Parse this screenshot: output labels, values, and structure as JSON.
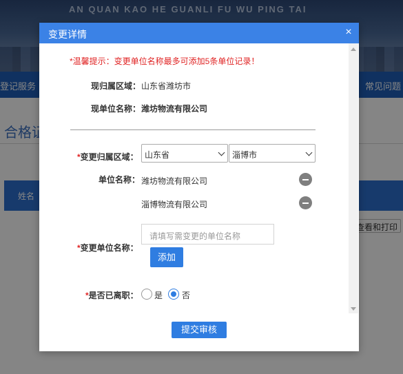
{
  "background": {
    "banner_subtitle": "AN QUAN KAO HE GUANLI FU WU PING TAI",
    "nav_left": "登记服务",
    "nav_right": "常见问题",
    "section_title": "合格证",
    "table_header_first": "姓名",
    "print_button": "查看和打印"
  },
  "dialog": {
    "title": "变更详情",
    "close_icon": "×",
    "tip": "*温馨提示：变更单位名称最多可添加5条单位记录！",
    "current_region_label": "现归属区域：",
    "current_region_value": "山东省潍坊市",
    "current_unit_label": "现单位名称：",
    "current_unit_value": "潍坊物流有限公司",
    "change_region_label": "变更归属区域：",
    "province_select": "山东省",
    "city_select": "淄博市",
    "unit_list_label": "单位名称：",
    "units": [
      "潍坊物流有限公司",
      "淄博物流有限公司"
    ],
    "change_unit_label": "变更单位名称：",
    "unit_input_placeholder": "请填写需变更的单位名称",
    "add_button": "添加",
    "resigned_label": "是否已离职：",
    "radio_yes": "是",
    "radio_no": "否",
    "resigned_selected": "否",
    "submit_button": "提交审核",
    "required_mark": "*"
  },
  "colors": {
    "primary": "#2f7de1",
    "header": "#3b82e6",
    "warning": "#e02424"
  }
}
